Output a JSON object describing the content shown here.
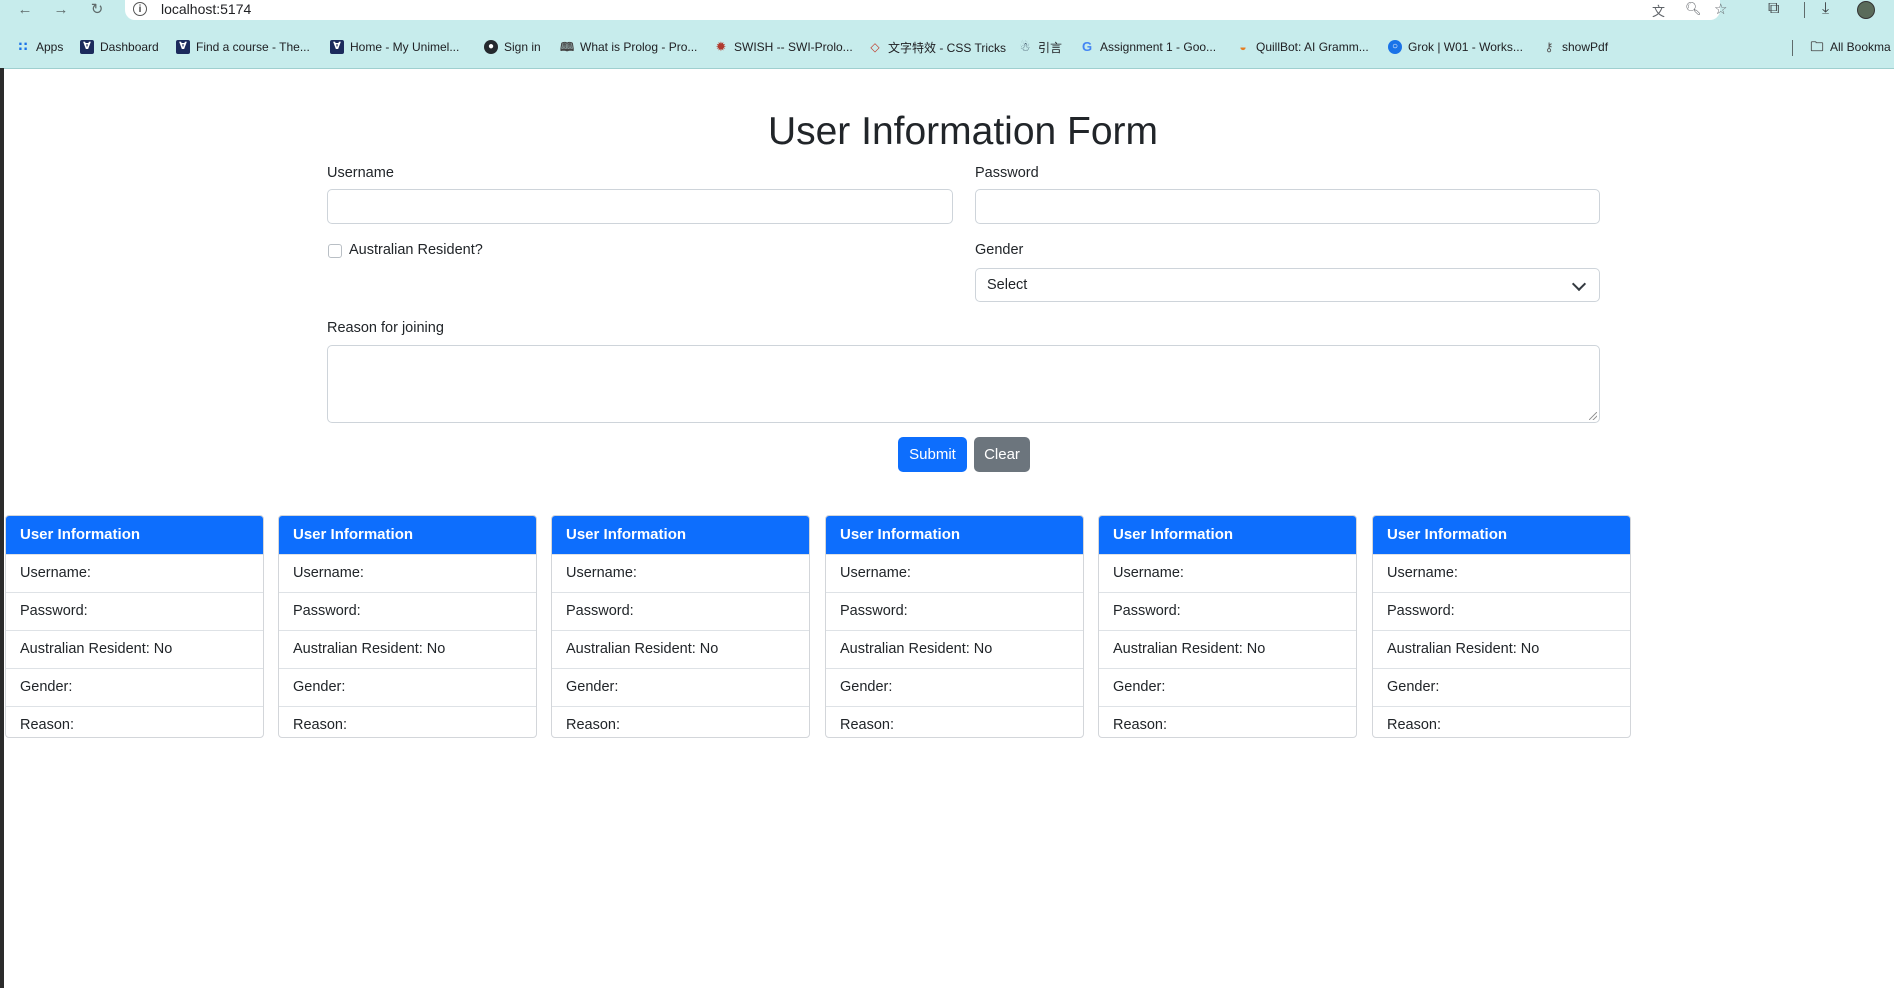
{
  "browser": {
    "url": "localhost:5174",
    "bookmarks": [
      {
        "label": "Apps",
        "icon": "apps-grid-icon"
      },
      {
        "label": "Dashboard",
        "icon": "unimelb-icon"
      },
      {
        "label": "Find a course - The...",
        "icon": "unimelb-icon"
      },
      {
        "label": "Home - My Unimel...",
        "icon": "unimelb-icon"
      },
      {
        "label": "Sign in",
        "icon": "github-icon"
      },
      {
        "label": "What is Prolog - Pro...",
        "icon": "book-icon"
      },
      {
        "label": "SWISH -- SWI-Prolo...",
        "icon": "swish-icon"
      },
      {
        "label": "文字特效 - CSS Tricks",
        "icon": "diamond-icon"
      },
      {
        "label": "引言",
        "icon": "robot-icon"
      },
      {
        "label": "Assignment 1 - Goo...",
        "icon": "google-icon"
      },
      {
        "label": "QuillBot: AI Gramm...",
        "icon": "quillbot-icon"
      },
      {
        "label": "Grok | W01 - Works...",
        "icon": "grok-icon"
      },
      {
        "label": "showPdf",
        "icon": "key-icon"
      }
    ],
    "all_bookmarks": "All Bookma"
  },
  "form": {
    "title": "User Information Form",
    "username_label": "Username",
    "password_label": "Password",
    "resident_label": "Australian Resident?",
    "gender_label": "Gender",
    "gender_selected": "Select",
    "reason_label": "Reason for joining",
    "submit_label": "Submit",
    "clear_label": "Clear"
  },
  "cards": [
    {
      "header": "User Information",
      "username": "Username:",
      "password": "Password:",
      "resident": "Australian Resident: No",
      "gender": "Gender:",
      "reason": "Reason:"
    },
    {
      "header": "User Information",
      "username": "Username:",
      "password": "Password:",
      "resident": "Australian Resident: No",
      "gender": "Gender:",
      "reason": "Reason:"
    },
    {
      "header": "User Information",
      "username": "Username:",
      "password": "Password:",
      "resident": "Australian Resident: No",
      "gender": "Gender:",
      "reason": "Reason:"
    },
    {
      "header": "User Information",
      "username": "Username:",
      "password": "Password:",
      "resident": "Australian Resident: No",
      "gender": "Gender:",
      "reason": "Reason:"
    },
    {
      "header": "User Information",
      "username": "Username:",
      "password": "Password:",
      "resident": "Australian Resident: No",
      "gender": "Gender:",
      "reason": "Reason:"
    },
    {
      "header": "User Information",
      "username": "Username:",
      "password": "Password:",
      "resident": "Australian Resident: No",
      "gender": "Gender:",
      "reason": "Reason:"
    }
  ],
  "colors": {
    "primary": "#0d6efd",
    "secondary": "#6c757d",
    "chrome_bg": "#c7ecec"
  }
}
